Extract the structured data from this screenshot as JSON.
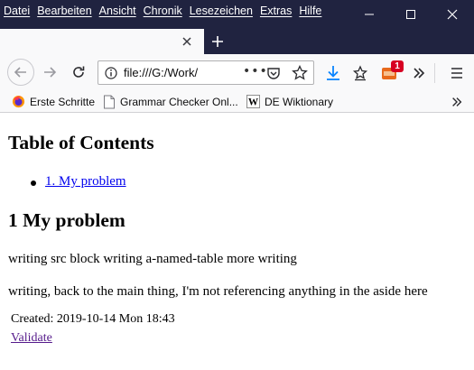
{
  "menubar": {
    "items": [
      "Datei",
      "Bearbeiten",
      "Ansicht",
      "Chronik",
      "Lesezeichen",
      "Extras",
      "Hilfe"
    ]
  },
  "window_controls": {
    "minimize": "minimize-icon",
    "maximize": "maximize-icon",
    "close": "close-icon"
  },
  "tab": {
    "title": "",
    "close_icon": "close-icon",
    "new_tab_icon": "plus-icon"
  },
  "navbar": {
    "back_icon": "arrow-left-icon",
    "forward_icon": "arrow-right-icon",
    "reload_icon": "reload-icon",
    "url": "file:///G:/Work/",
    "page_actions": "•••",
    "download_icon": "download-icon",
    "library_icon": "library-icon",
    "extension_badge": "1",
    "overflow_icon": "double-chevron-icon",
    "menu_icon": "hamburger-icon"
  },
  "bookmarks": {
    "items": [
      {
        "label": "Erste Schritte",
        "icon": "firefox-icon"
      },
      {
        "label": "Grammar Checker Onl...",
        "icon": "page-icon"
      },
      {
        "label": "DE Wiktionary",
        "icon": "wikipedia-icon"
      }
    ]
  },
  "content": {
    "toc_heading": "Table of Contents",
    "toc_items": [
      "1. My problem"
    ],
    "section_heading": "1 My problem",
    "paragraphs": [
      "writing src block writing a-named-table more writing",
      "writing, back to the main thing, I'm not referencing anything in the aside here"
    ],
    "created": "Created: 2019-10-14 Mon 18:43",
    "validate": "Validate"
  },
  "colors": {
    "titlebar": "#202340",
    "toolbar": "#f9f9fa",
    "link": "#0000ee",
    "visited_link": "#551a8b",
    "download_accent": "#0a84ff",
    "badge": "#d70022"
  }
}
